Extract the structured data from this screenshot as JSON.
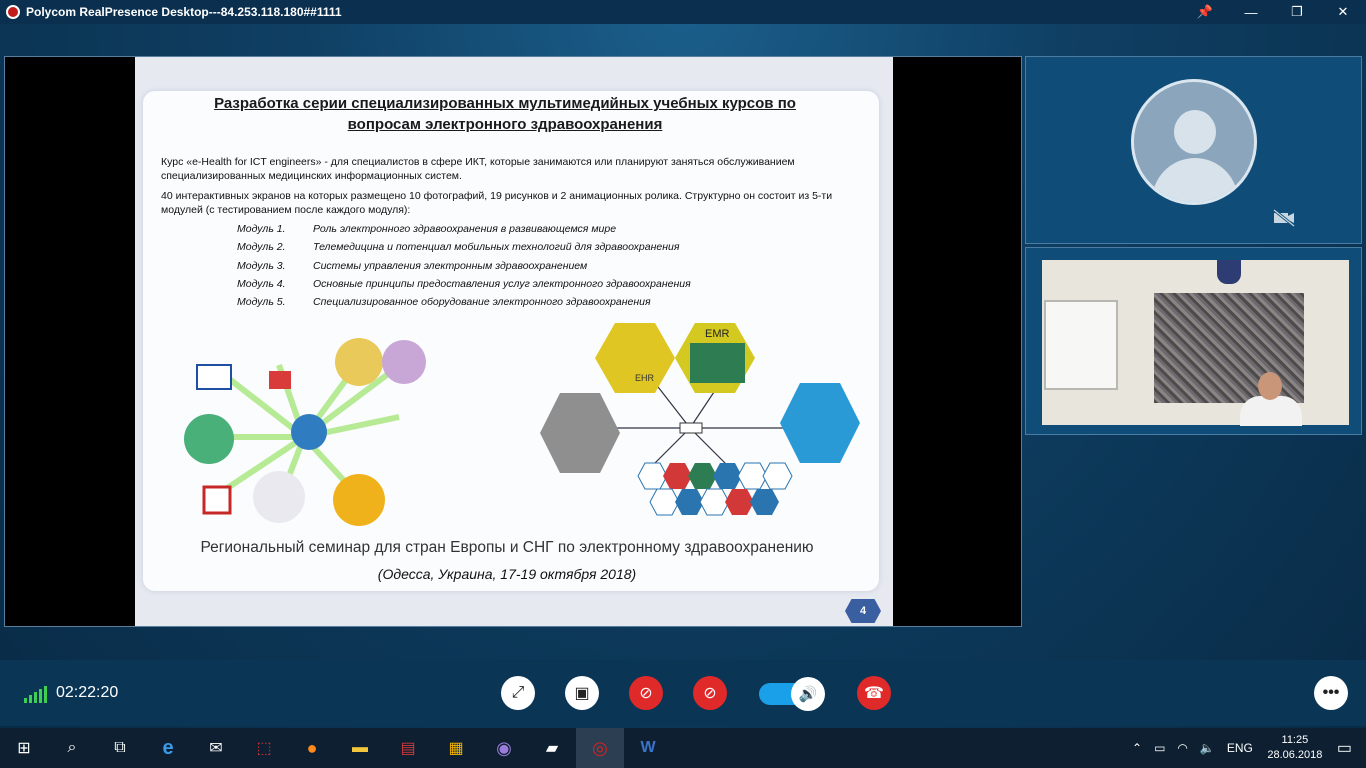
{
  "window": {
    "title": "Polycom RealPresence Desktop---84.253.118.180##1111",
    "buttons": {
      "pin": "📌",
      "minimize": "—",
      "restore": "❐",
      "close": "✕"
    }
  },
  "slide": {
    "title_line1": "Разработка серии специализированных мультимедийных учебных курсов по",
    "title_line2": "вопросам электронного здравоохранения",
    "para1": "Курс «e-Health for ICT engineers» - для специалистов в сфере ИКТ, которые занимаются или планируют заняться обслуживанием специализированных медицинских информационных систем.",
    "para2": "40 интерактивных экранов на которых размещено 10 фотографий, 19 рисунков и 2 анимационных ролика. Структурно он состоит из 5-ти модулей (с тестированием после каждого модуля):",
    "modules": [
      {
        "num": "Модуль 1.",
        "text": "Роль электронного здравоохранения в развивающемся мире"
      },
      {
        "num": "Модуль 2.",
        "text": "Телемедицина и потенциал мобильных технологий для здравоохранения"
      },
      {
        "num": "Модуль 3.",
        "text": "Системы управления электронным здравоохранением"
      },
      {
        "num": "Модуль 4.",
        "text": "Основные принципы предоставления услуг электронного здравоохранения"
      },
      {
        "num": "Модуль 5.",
        "text": "Специализированное оборудование электронного здравоохранения"
      }
    ],
    "ehr_label": "EHR",
    "emr_label": "EMR",
    "footer1": "Региональный семинар для стран Европы и СНГ по электронному здравоохранению",
    "footer2": "(Одесса, Украина, 17-19 октября 2018)",
    "page_number": "4"
  },
  "selfview": {
    "camera_status_icon": "camera-off-icon"
  },
  "controls": {
    "timer": "02:22:20",
    "signal_icon": "signal-bars-icon"
  },
  "taskbar": {
    "language": "ENG",
    "time": "11:25",
    "date": "28.06.2018"
  },
  "colors": {
    "hangup": "#e02a2a",
    "volume": "#1aa0e8",
    "signal": "#3dcf52"
  }
}
